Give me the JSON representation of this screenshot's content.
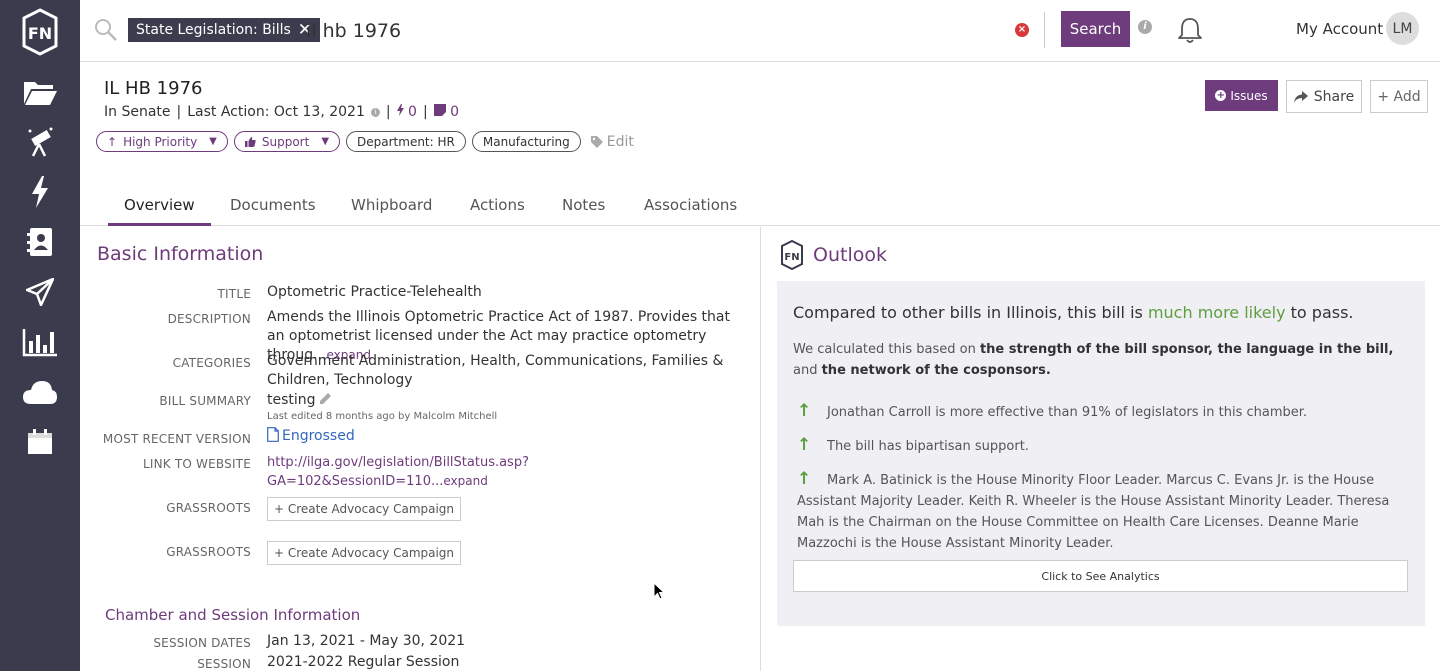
{
  "search": {
    "chip_label": "State Legislation: Bills",
    "query": "il hb 1976",
    "button_label": "Search"
  },
  "account": {
    "label": "My Account",
    "initials": "LM"
  },
  "bill": {
    "title": "IL HB 1976",
    "status": "In Senate",
    "last_action": "Last Action: Oct 13, 2021",
    "actions_count": "0",
    "notes_count": "0"
  },
  "tags": {
    "priority": "High Priority",
    "position": "Support",
    "department": "Department: HR",
    "industry": "Manufacturing",
    "edit_label": "Edit"
  },
  "header_buttons": {
    "issues": "Issues",
    "share": "Share",
    "add": "+ Add"
  },
  "tabs": [
    "Overview",
    "Documents",
    "Whipboard",
    "Actions",
    "Notes",
    "Associations"
  ],
  "basic_info": {
    "section_title": "Basic Information",
    "title_label": "TITLE",
    "title_value": "Optometric Practice-Telehealth",
    "description_label": "DESCRIPTION",
    "description_value": "Amends the Illinois Optometric Practice Act of 1987. Provides that an optometrist licensed under the Act may practice optometry throug...",
    "expand_label": "expand",
    "categories_label": "CATEGORIES",
    "categories_value": "Government Administration, Health, Communications, Families & Children, Technology",
    "bill_summary_label": "BILL SUMMARY",
    "bill_summary_value": "testing",
    "last_edited": "Last edited 8 months ago by Malcolm Mitchell",
    "recent_version_label": "MOST RECENT VERSION",
    "recent_version_value": "Engrossed",
    "website_label": "LINK TO WEBSITE",
    "website_value": "http://ilga.gov/legislation/BillStatus.asp?GA=102&SessionID=110...",
    "grassroots_label": "GRASSROOTS",
    "campaign_button": "+ Create Advocacy Campaign"
  },
  "chamber": {
    "section_title": "Chamber and Session Information",
    "session_dates_label": "SESSION DATES",
    "session_dates_value": "Jan 13, 2021 - May 30, 2021",
    "session_label": "SESSION",
    "session_value": "2021-2022 Regular Session"
  },
  "outlook": {
    "title": "Outlook",
    "headline_pre": "Compared to other bills in Illinois, this bill is ",
    "headline_highlight": "much more likely",
    "headline_post": " to pass.",
    "calc_pre": "We calculated this based on ",
    "calc_b1": "the strength of the bill sponsor, the language in the bill,",
    "calc_mid": " and ",
    "calc_b2": "the network of the cosponsors.",
    "reasons": [
      "Jonathan Carroll is more effective than 91% of legislators in this chamber.",
      "The bill has bipartisan support.",
      "Mark A. Batinick is the House Minority Floor Leader. Marcus C. Evans Jr. is the House Assistant Majority Leader. Keith R. Wheeler is the House Assistant Minority Leader. Theresa Mah is the Chairman on the House Committee on Health Care Licenses. Deanne Marie Mazzochi is the House Assistant Minority Leader."
    ],
    "analytics_button": "Click to See Analytics"
  },
  "colors": {
    "sidebar": "#3a3b4d",
    "accent": "#6e3b7c",
    "positive": "#5d9e3e"
  },
  "icons": [
    "fiscalnote-logo",
    "folder-icon",
    "telescope-icon",
    "lightning-icon",
    "contact-book-icon",
    "paper-plane-icon",
    "bar-chart-icon",
    "cloud-icon",
    "calendar-icon",
    "search-icon",
    "bell-icon"
  ]
}
